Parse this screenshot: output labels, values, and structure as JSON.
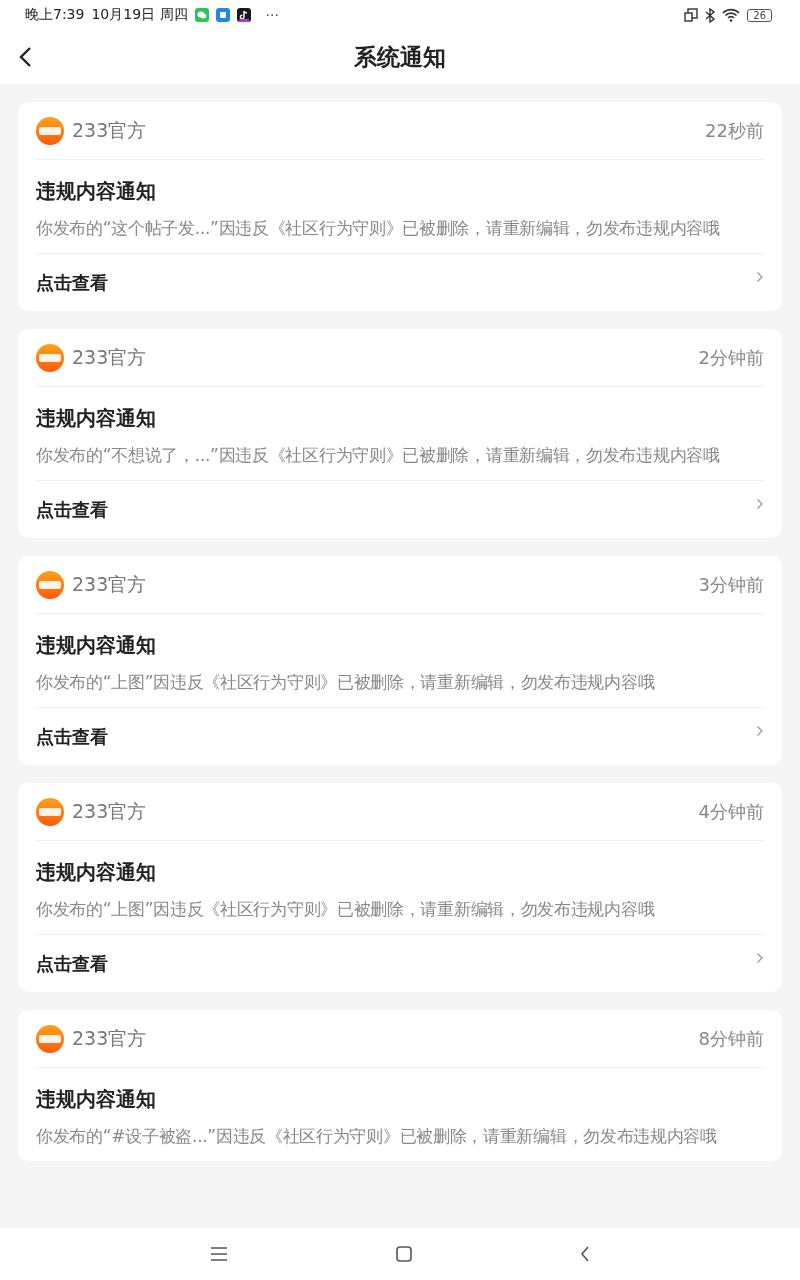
{
  "status_bar": {
    "time": "晚上7:39",
    "date": "10月19日 周四",
    "more": "···",
    "battery": "26"
  },
  "header": {
    "title": "系统通知"
  },
  "notifications": [
    {
      "sender": "233官方",
      "time": "22秒前",
      "title": "违规内容通知",
      "body": "你发布的“这个帖子发...”因违反《社区行为守则》已被删除，请重新编辑，勿发布违规内容哦",
      "link": "点击查看"
    },
    {
      "sender": "233官方",
      "time": "2分钟前",
      "title": "违规内容通知",
      "body": "你发布的“不想说了，...”因违反《社区行为守则》已被删除，请重新编辑，勿发布违规内容哦",
      "link": "点击查看"
    },
    {
      "sender": "233官方",
      "time": "3分钟前",
      "title": "违规内容通知",
      "body": "你发布的“上图”因违反《社区行为守则》已被删除，请重新编辑，勿发布违规内容哦",
      "link": "点击查看"
    },
    {
      "sender": "233官方",
      "time": "4分钟前",
      "title": "违规内容通知",
      "body": "你发布的“上图”因违反《社区行为守则》已被删除，请重新编辑，勿发布违规内容哦",
      "link": "点击查看"
    },
    {
      "sender": "233官方",
      "time": "8分钟前",
      "title": "违规内容通知",
      "body": "你发布的“#设子被盗...”因违反《社区行为守则》已被删除，请重新编辑，勿发布违规内容哦"
    }
  ]
}
